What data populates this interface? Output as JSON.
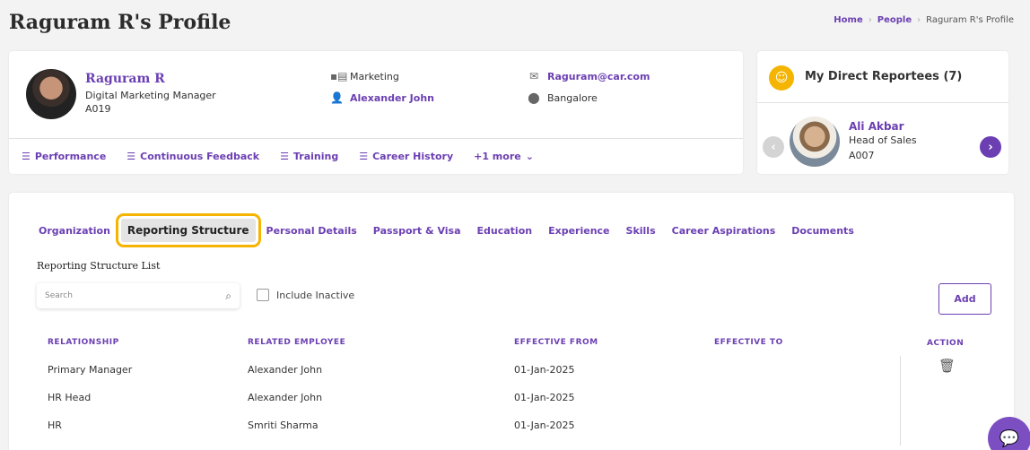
{
  "page": {
    "title": "Raguram R's Profile",
    "breadcrumb": [
      "Home",
      "People",
      "Raguram R's Profile"
    ]
  },
  "profile": {
    "name": "Raguram R",
    "designation": "Digital Marketing Manager",
    "employee_id": "A019",
    "department": "Marketing",
    "manager": "Alexander John",
    "email": "Raguram@car.com",
    "location": "Bangalore",
    "links": [
      "Performance",
      "Continuous Feedback",
      "Training",
      "Career History"
    ],
    "more_link": "+1 more"
  },
  "reportees": {
    "title": "My Direct Reportees (7)",
    "current": {
      "name": "Ali Akbar",
      "role": "Head of Sales",
      "id": "A007"
    }
  },
  "tabs": [
    "Organization",
    "Reporting Structure",
    "Personal Details",
    "Passport & Visa",
    "Education",
    "Experience",
    "Skills",
    "Career Aspirations",
    "Documents"
  ],
  "active_tab": "Reporting Structure",
  "reporting": {
    "section_title": "Reporting Structure List",
    "search_placeholder": "Search",
    "include_inactive_label": "Include Inactive",
    "add_label": "Add",
    "columns": [
      "RELATIONSHIP",
      "RELATED EMPLOYEE",
      "EFFECTIVE FROM",
      "EFFECTIVE TO",
      "ACTION"
    ],
    "rows": [
      {
        "relationship": "Primary Manager",
        "employee": "Alexander John",
        "from": "01-Jan-2025",
        "to": ""
      },
      {
        "relationship": "HR Head",
        "employee": "Alexander John",
        "from": "01-Jan-2025",
        "to": ""
      },
      {
        "relationship": "HR",
        "employee": "Smriti Sharma",
        "from": "01-Jan-2025",
        "to": ""
      }
    ]
  },
  "colors": {
    "accent": "#6b3fb2",
    "highlight": "#f4b400",
    "background": "#f3f3f3"
  }
}
